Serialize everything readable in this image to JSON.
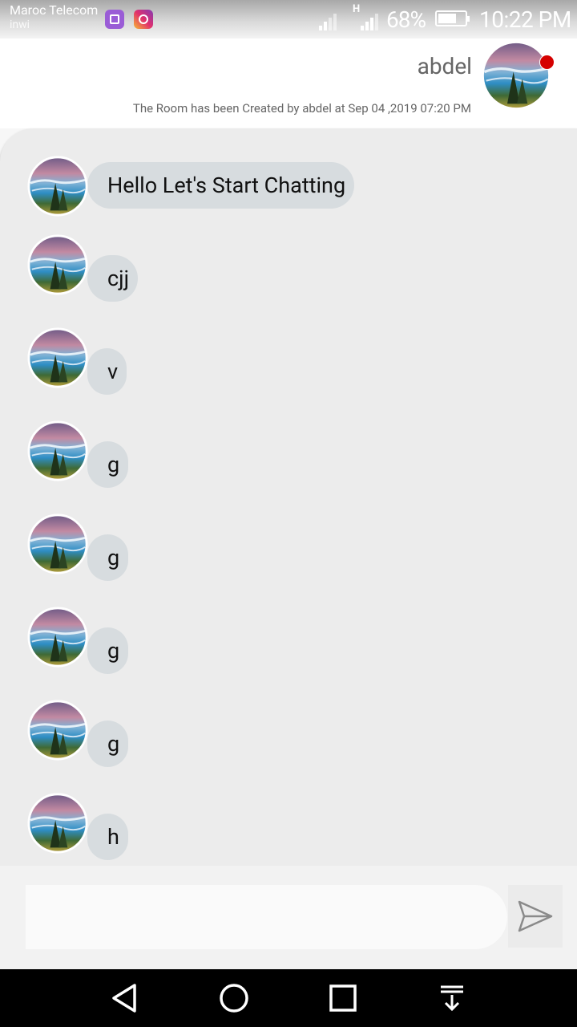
{
  "status_bar": {
    "carrier_primary": "Maroc Telecom",
    "carrier_secondary": "inwi",
    "network_type": "H",
    "battery_percent": "68%",
    "battery_level": 0.68,
    "time": "10:22 PM",
    "notification_icons": [
      "gallery-icon",
      "instagram-icon"
    ]
  },
  "header": {
    "name": "abdel",
    "created_text": "The Room has been Created by abdel  at Sep 04 ,2019 07:20 PM",
    "online_status_color": "#d50000"
  },
  "messages": [
    {
      "text": "Hello Let's Start Chatting"
    },
    {
      "text": "cjj"
    },
    {
      "text": "v"
    },
    {
      "text": "g"
    },
    {
      "text": "g"
    },
    {
      "text": "g"
    },
    {
      "text": "g"
    },
    {
      "text": "h"
    }
  ],
  "composer": {
    "placeholder": "",
    "send_icon": "send-icon"
  },
  "nav_bar": {
    "icons": [
      "back-icon",
      "home-icon",
      "recents-icon",
      "notification-pull-icon"
    ]
  },
  "colors": {
    "chat_background": "#ececec",
    "bubble": "#d7dcdf",
    "header_background": "#ffffff"
  }
}
